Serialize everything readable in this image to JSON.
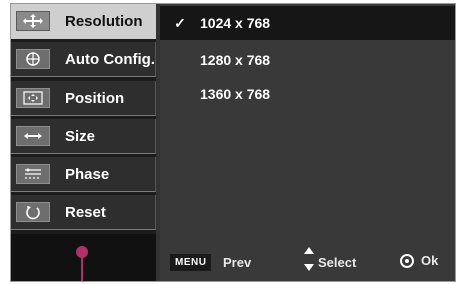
{
  "sidebar": {
    "items": [
      {
        "label": "Resolution",
        "icon": "move-arrows-icon"
      },
      {
        "label": "Auto Config.",
        "icon": "auto-config-icon"
      },
      {
        "label": "Position",
        "icon": "position-icon"
      },
      {
        "label": "Size",
        "icon": "size-arrows-icon"
      },
      {
        "label": "Phase",
        "icon": "phase-icon"
      },
      {
        "label": "Reset",
        "icon": "reset-icon"
      }
    ],
    "active_index": 0
  },
  "options": {
    "items": [
      "1024 x 768",
      "1280 x 768",
      "1360 x 768"
    ],
    "selected_index": 0,
    "check_mark": "✓"
  },
  "footer": {
    "menu_key": "MENU",
    "prev_label": "Prev",
    "select_label": "Select",
    "ok_label": "Ok"
  },
  "colors": {
    "accent": "#b0306a",
    "active_item": "#cfcfcf",
    "panel": "#393939"
  }
}
